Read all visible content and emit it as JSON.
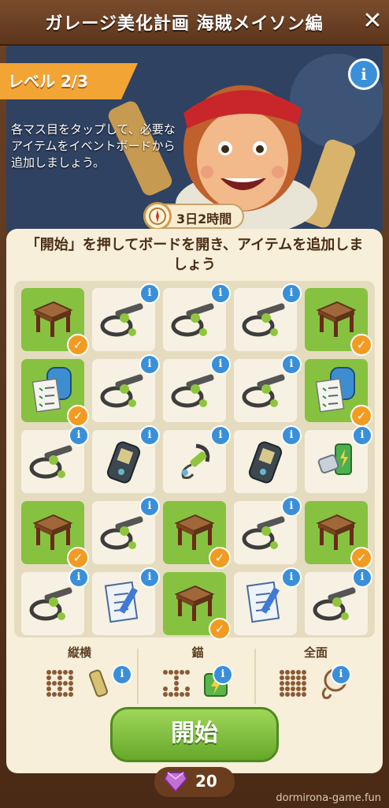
{
  "header": {
    "title": "ガレージ美化計画 海賊メイソン編",
    "close_label": "✕"
  },
  "level": {
    "label": "レベル 2/3"
  },
  "info_label": "i",
  "description": "各マス目をタップして、必要なアイテムをイベントボードから追加しましょう。",
  "timer": {
    "value": "3日2時間"
  },
  "instruction": "「開始」を押してボードを開き、アイテムを追加しましょう",
  "grid": {
    "rows": [
      [
        {
          "item": "table-icon",
          "done": true
        },
        {
          "item": "metal-detector-icon",
          "done": false
        },
        {
          "item": "metal-detector-icon",
          "done": false
        },
        {
          "item": "metal-detector-icon",
          "done": false
        },
        {
          "item": "table-icon",
          "done": true
        }
      ],
      [
        {
          "item": "backpack-checklist-icon",
          "done": true
        },
        {
          "item": "metal-detector-icon",
          "done": false
        },
        {
          "item": "metal-detector-icon",
          "done": false
        },
        {
          "item": "metal-detector-icon",
          "done": false
        },
        {
          "item": "backpack-checklist-icon",
          "done": true
        }
      ],
      [
        {
          "item": "metal-detector-icon",
          "done": false
        },
        {
          "item": "gps-device-icon",
          "done": false
        },
        {
          "item": "headphones-cable-icon",
          "done": false
        },
        {
          "item": "gps-device-icon",
          "done": false
        },
        {
          "item": "batteries-icon",
          "done": false
        }
      ],
      [
        {
          "item": "table-icon",
          "done": true
        },
        {
          "item": "metal-detector-icon",
          "done": false
        },
        {
          "item": "table-icon",
          "done": true
        },
        {
          "item": "metal-detector-icon",
          "done": false
        },
        {
          "item": "table-icon",
          "done": true
        }
      ],
      [
        {
          "item": "metal-detector-icon",
          "done": false
        },
        {
          "item": "notepad-pencil-icon",
          "done": false
        },
        {
          "item": "table-icon",
          "done": true
        },
        {
          "item": "notepad-pencil-icon",
          "done": false
        },
        {
          "item": "metal-detector-icon",
          "done": false
        }
      ]
    ]
  },
  "patterns": [
    {
      "name": "縦横",
      "icon": "battery-icon"
    },
    {
      "name": "錨",
      "icon": "battery-pack-icon"
    },
    {
      "name": "全面",
      "icon": "pocket-watch-icon"
    }
  ],
  "start_button": {
    "label": "開始"
  },
  "cost": {
    "value": "20",
    "icon": "gem-icon"
  },
  "watermark": "dormirona-game.fun",
  "colors": {
    "accent_green": "#86c240",
    "check_orange": "#f29b22",
    "info_blue": "#3a8fd9",
    "level_banner": "#f2a435"
  }
}
